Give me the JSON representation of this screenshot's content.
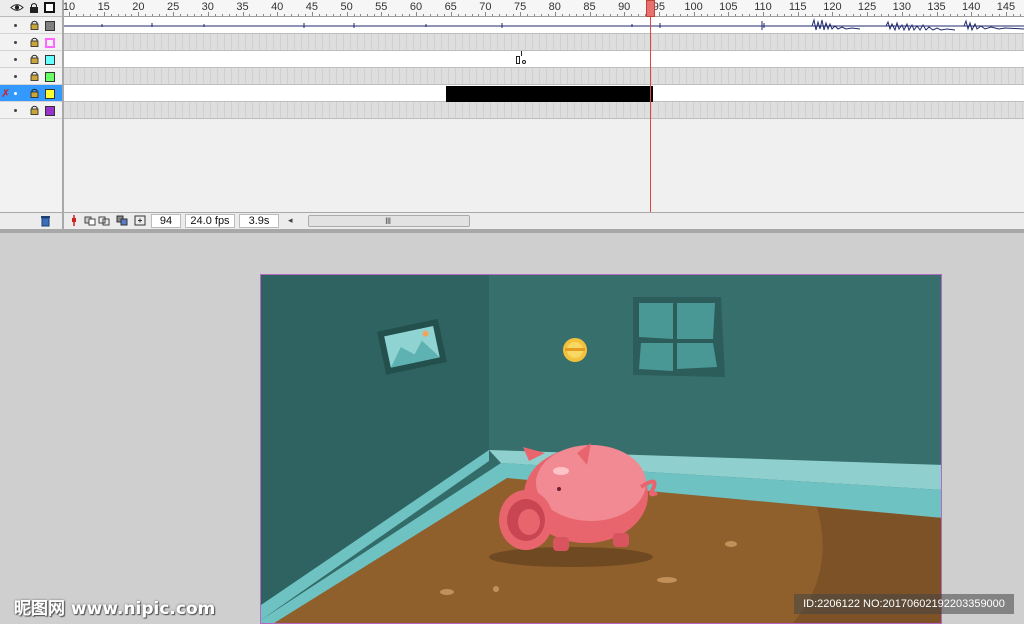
{
  "ruler": {
    "labels": [
      "10",
      "15",
      "20",
      "25",
      "30",
      "35",
      "40",
      "45",
      "50",
      "55",
      "60",
      "65",
      "70",
      "75",
      "80",
      "85",
      "90",
      "95",
      "100",
      "105",
      "110",
      "115",
      "120",
      "125",
      "130",
      "135",
      "140",
      "145"
    ]
  },
  "layers": [
    {
      "color": "#808080",
      "style": "filled"
    },
    {
      "color": "#ff66ff",
      "style": "outline"
    },
    {
      "color": "#66ffff",
      "style": "filled"
    },
    {
      "color": "#66ff66",
      "style": "filled"
    },
    {
      "color": "#ffff33",
      "style": "filled",
      "selected": true
    },
    {
      "color": "#9933cc",
      "style": "filled"
    }
  ],
  "status": {
    "frame": "94",
    "fps": "24.0 fps",
    "time": "3.9s"
  },
  "colors": {
    "accent": "#3399ff",
    "playhead": "#d44444",
    "stage_wall": "#336b68",
    "stage_floor": "#8f5f2c",
    "pig": "#f27d88"
  },
  "watermark": {
    "left": "昵图网 www.nipic.com",
    "right": "ID:2206122 NO:20170602192203359000"
  },
  "icons": [
    "eye-icon",
    "lock-icon",
    "outline-icon",
    "trash-icon",
    "onion-skin-icon",
    "edit-multiple-frames-icon",
    "scroll-left-icon",
    "scroll-grip-icon"
  ]
}
